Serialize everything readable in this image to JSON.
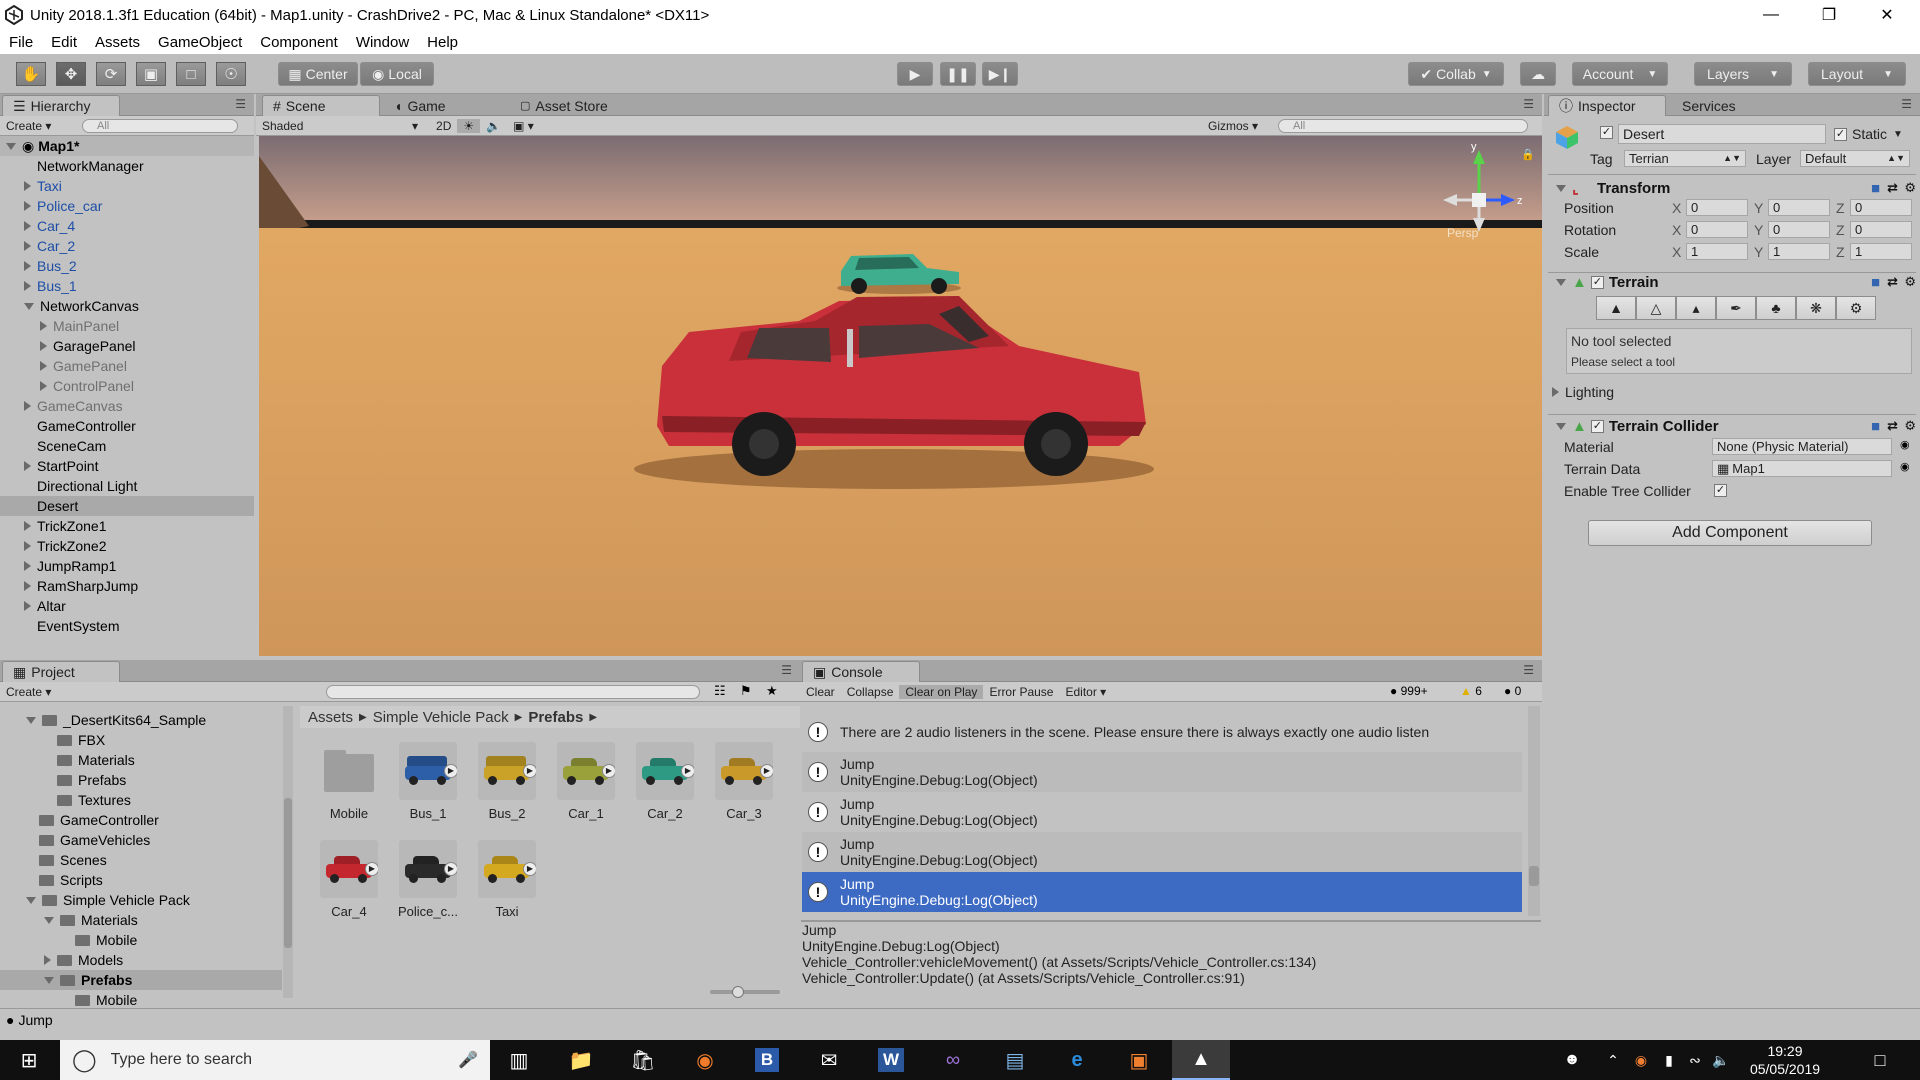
{
  "title": "Unity 2018.1.3f1 Education (64bit) - Map1.unity - CrashDrive2 - PC, Mac & Linux Standalone* <DX11>",
  "menu": [
    "File",
    "Edit",
    "Assets",
    "GameObject",
    "Component",
    "Window",
    "Help"
  ],
  "toolbar": {
    "center": "Center",
    "local": "Local",
    "collab": "Collab",
    "account": "Account",
    "layers": "Layers",
    "layout": "Layout"
  },
  "hierarchy": {
    "tab": "Hierarchy",
    "create": "Create",
    "search_placeholder": "All",
    "scene": "Map1*",
    "items": [
      {
        "label": "NetworkManager",
        "indent": 0,
        "arrow": "none",
        "style": "normal"
      },
      {
        "label": "Taxi",
        "indent": 0,
        "arrow": "right",
        "style": "blue"
      },
      {
        "label": "Police_car",
        "indent": 0,
        "arrow": "right",
        "style": "blue"
      },
      {
        "label": "Car_4",
        "indent": 0,
        "arrow": "right",
        "style": "blue"
      },
      {
        "label": "Car_2",
        "indent": 0,
        "arrow": "right",
        "style": "blue"
      },
      {
        "label": "Bus_2",
        "indent": 0,
        "arrow": "right",
        "style": "blue"
      },
      {
        "label": "Bus_1",
        "indent": 0,
        "arrow": "right",
        "style": "blue"
      },
      {
        "label": "NetworkCanvas",
        "indent": 0,
        "arrow": "down",
        "style": "normal"
      },
      {
        "label": "MainPanel",
        "indent": 1,
        "arrow": "right",
        "style": "grey"
      },
      {
        "label": "GaragePanel",
        "indent": 1,
        "arrow": "right",
        "style": "normal"
      },
      {
        "label": "GamePanel",
        "indent": 1,
        "arrow": "right",
        "style": "grey"
      },
      {
        "label": "ControlPanel",
        "indent": 1,
        "arrow": "right",
        "style": "grey"
      },
      {
        "label": "GameCanvas",
        "indent": 0,
        "arrow": "right",
        "style": "grey"
      },
      {
        "label": "GameController",
        "indent": 0,
        "arrow": "none",
        "style": "normal"
      },
      {
        "label": "SceneCam",
        "indent": 0,
        "arrow": "none",
        "style": "normal"
      },
      {
        "label": "StartPoint",
        "indent": 0,
        "arrow": "right",
        "style": "normal"
      },
      {
        "label": "Directional Light",
        "indent": 0,
        "arrow": "none",
        "style": "normal"
      },
      {
        "label": "Desert",
        "indent": 0,
        "arrow": "none",
        "style": "selected"
      },
      {
        "label": "TrickZone1",
        "indent": 0,
        "arrow": "right",
        "style": "normal"
      },
      {
        "label": "TrickZone2",
        "indent": 0,
        "arrow": "right",
        "style": "normal"
      },
      {
        "label": "JumpRamp1",
        "indent": 0,
        "arrow": "right",
        "style": "normal"
      },
      {
        "label": "RamSharpJump",
        "indent": 0,
        "arrow": "right",
        "style": "normal"
      },
      {
        "label": "Altar",
        "indent": 0,
        "arrow": "right",
        "style": "normal"
      },
      {
        "label": "EventSystem",
        "indent": 0,
        "arrow": "none",
        "style": "normal"
      }
    ]
  },
  "scene_view": {
    "tabs": [
      "Scene",
      "Game",
      "Asset Store"
    ],
    "shading": "Shaded",
    "mode_2d": "2D",
    "gizmos": "Gizmos",
    "search_placeholder": "All",
    "persp": "Persp"
  },
  "inspector": {
    "tabs": [
      "Inspector",
      "Services"
    ],
    "object_name": "Desert",
    "static_label": "Static",
    "tag_label": "Tag",
    "tag_value": "Terrian",
    "layer_label": "Layer",
    "layer_value": "Default",
    "transform": {
      "title": "Transform",
      "rows": [
        {
          "label": "Position",
          "x": "0",
          "y": "0",
          "z": "0"
        },
        {
          "label": "Rotation",
          "x": "0",
          "y": "0",
          "z": "0"
        },
        {
          "label": "Scale",
          "x": "1",
          "y": "1",
          "z": "1"
        }
      ]
    },
    "terrain": {
      "title": "Terrain",
      "no_tool": "No tool selected",
      "please_select": "Please select a tool",
      "lighting": "Lighting"
    },
    "terrain_collider": {
      "title": "Terrain Collider",
      "material_label": "Material",
      "material_value": "None (Physic Material)",
      "data_label": "Terrain Data",
      "data_value": "Map1",
      "tree_label": "Enable Tree Collider"
    },
    "add_component": "Add Component"
  },
  "project": {
    "tab": "Project",
    "create": "Create",
    "tree": [
      {
        "label": "_DesertKits64_Sample",
        "indent": 0,
        "arrow": "down"
      },
      {
        "label": "FBX",
        "indent": 1,
        "arrow": "none"
      },
      {
        "label": "Materials",
        "indent": 1,
        "arrow": "none"
      },
      {
        "label": "Prefabs",
        "indent": 1,
        "arrow": "none"
      },
      {
        "label": "Textures",
        "indent": 1,
        "arrow": "none"
      },
      {
        "label": "GameController",
        "indent": 0,
        "arrow": "none"
      },
      {
        "label": "GameVehicles",
        "indent": 0,
        "arrow": "none"
      },
      {
        "label": "Scenes",
        "indent": 0,
        "arrow": "none"
      },
      {
        "label": "Scripts",
        "indent": 0,
        "arrow": "none"
      },
      {
        "label": "Simple Vehicle Pack",
        "indent": 0,
        "arrow": "down"
      },
      {
        "label": "Materials",
        "indent": 1,
        "arrow": "down"
      },
      {
        "label": "Mobile",
        "indent": 2,
        "arrow": "none"
      },
      {
        "label": "Models",
        "indent": 1,
        "arrow": "right"
      },
      {
        "label": "Prefabs",
        "indent": 1,
        "arrow": "down",
        "selected": true
      },
      {
        "label": "Mobile",
        "indent": 2,
        "arrow": "none"
      }
    ],
    "breadcrumb": [
      "Assets",
      "Simple Vehicle Pack",
      "Prefabs"
    ],
    "assets": [
      {
        "label": "Mobile",
        "kind": "folder",
        "color": "#9e9e9e"
      },
      {
        "label": "Bus_1",
        "kind": "bus",
        "color": "#2d5fa8"
      },
      {
        "label": "Bus_2",
        "kind": "bus",
        "color": "#c9a227"
      },
      {
        "label": "Car_1",
        "kind": "car",
        "color": "#9aa03a"
      },
      {
        "label": "Car_2",
        "kind": "car",
        "color": "#2e9a84"
      },
      {
        "label": "Car_3",
        "kind": "car",
        "color": "#c99a2a"
      },
      {
        "label": "Car_4",
        "kind": "car",
        "color": "#c5272e"
      },
      {
        "label": "Police_c...",
        "kind": "car",
        "color": "#2a2a2a"
      },
      {
        "label": "Taxi",
        "kind": "car",
        "color": "#d4a81f"
      }
    ]
  },
  "console": {
    "tab": "Console",
    "buttons": [
      "Clear",
      "Collapse",
      "Clear on Play",
      "Error Pause",
      "Editor"
    ],
    "counts": {
      "info": "999+",
      "warn": "6",
      "error": "0"
    },
    "messages": [
      {
        "l1": "There are 2 audio listeners in the scene. Please ensure there is always exactly one audio listen",
        "l2": "",
        "selected": false
      },
      {
        "l1": "Jump",
        "l2": "UnityEngine.Debug:Log(Object)",
        "selected": false
      },
      {
        "l1": "Jump",
        "l2": "UnityEngine.Debug:Log(Object)",
        "selected": false
      },
      {
        "l1": "Jump",
        "l2": "UnityEngine.Debug:Log(Object)",
        "selected": false
      },
      {
        "l1": "Jump",
        "l2": "UnityEngine.Debug:Log(Object)",
        "selected": true
      }
    ],
    "detail": [
      "Jump",
      "UnityEngine.Debug:Log(Object)",
      "Vehicle_Controller:vehicleMovement() (at Assets/Scripts/Vehicle_Controller.cs:134)",
      "Vehicle_Controller:Update() (at Assets/Scripts/Vehicle_Controller.cs:91)"
    ]
  },
  "statusbar": {
    "text": "Jump"
  },
  "taskbar": {
    "search_placeholder": "Type here to search",
    "time": "19:29",
    "date": "05/05/2019"
  },
  "colors": {
    "selection": "#3d6bc4",
    "editor_bg": "#c2c2c2",
    "sand": "#d49c5c"
  }
}
